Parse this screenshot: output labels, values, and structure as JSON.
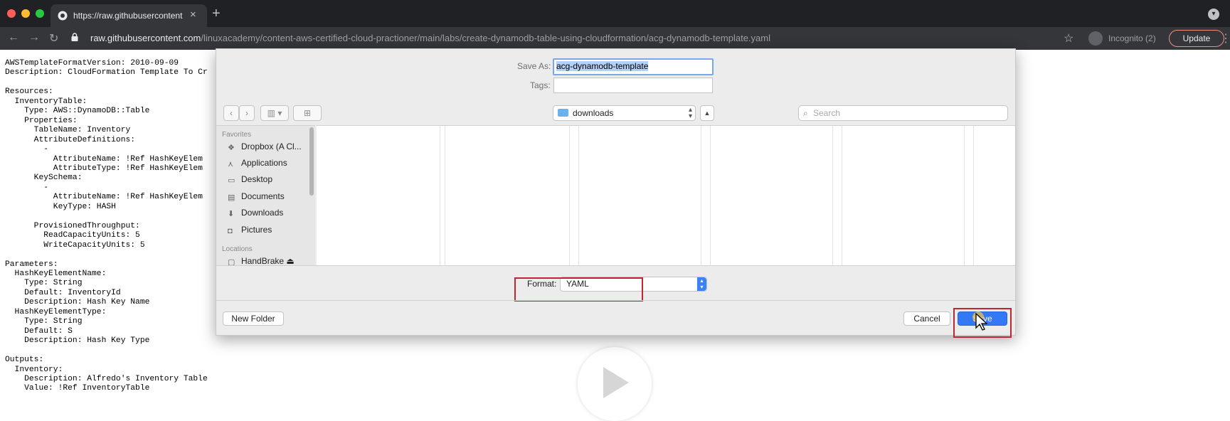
{
  "browser": {
    "tab_title": "https://raw.githubusercontent",
    "url_host": "raw.githubusercontent.com",
    "url_path": "/linuxacademy/content-aws-certified-cloud-practioner/main/labs/create-dynamodb-table-using-cloudformation/acg-dynamodb-template.yaml",
    "incognito_label": "Incognito (2)",
    "update_label": "Update",
    "icons": [
      "back-arrow-icon",
      "forward-arrow-icon",
      "reload-icon",
      "lock-icon",
      "star-icon",
      "incognito-icon",
      "menu-icon"
    ],
    "window_colors": [
      "#ff5f57",
      "#febc2e",
      "#28c840"
    ]
  },
  "page": {
    "yaml_lines": [
      "AWSTemplateFormatVersion: 2010-09-09",
      "Description: CloudFormation Template To Cr",
      "",
      "Resources:",
      "  InventoryTable:",
      "    Type: AWS::DynamoDB::Table",
      "    Properties:",
      "      TableName: Inventory",
      "      AttributeDefinitions:",
      "        -",
      "          AttributeName: !Ref HashKeyElem",
      "          AttributeType: !Ref HashKeyElem",
      "      KeySchema:",
      "        -",
      "          AttributeName: !Ref HashKeyElem",
      "          KeyType: HASH",
      "",
      "      ProvisionedThroughput:",
      "        ReadCapacityUnits: 5",
      "        WriteCapacityUnits: 5",
      "",
      "Parameters:",
      "  HashKeyElementName:",
      "    Type: String",
      "    Default: InventoryId",
      "    Description: Hash Key Name",
      "  HashKeyElementType:",
      "    Type: String",
      "    Default: S",
      "    Description: Hash Key Type",
      "",
      "Outputs:",
      "  Inventory:",
      "    Description: Alfredo's Inventory Table",
      "    Value: !Ref InventoryTable"
    ]
  },
  "dialog": {
    "save_as_label": "Save As:",
    "save_as_value": "acg-dynamodb-template",
    "tags_label": "Tags:",
    "location": "downloads",
    "search_placeholder": "Search",
    "favorites_header": "Favorites",
    "favorites": [
      "Dropbox (A Cl...",
      "Applications",
      "Desktop",
      "Documents",
      "Downloads",
      "Pictures"
    ],
    "favorites_icons": [
      "dropbox-icon",
      "applications-icon",
      "desktop-icon",
      "documents-icon",
      "downloads-icon",
      "pictures-icon"
    ],
    "locations_header": "Locations",
    "locations": [
      "HandBrake"
    ],
    "format_label": "Format:",
    "format_value": "YAML",
    "new_folder_label": "New Folder",
    "cancel_label": "Cancel",
    "save_label": "Save",
    "highlight_color": "#c0262d",
    "accent_color": "#3478f6"
  }
}
